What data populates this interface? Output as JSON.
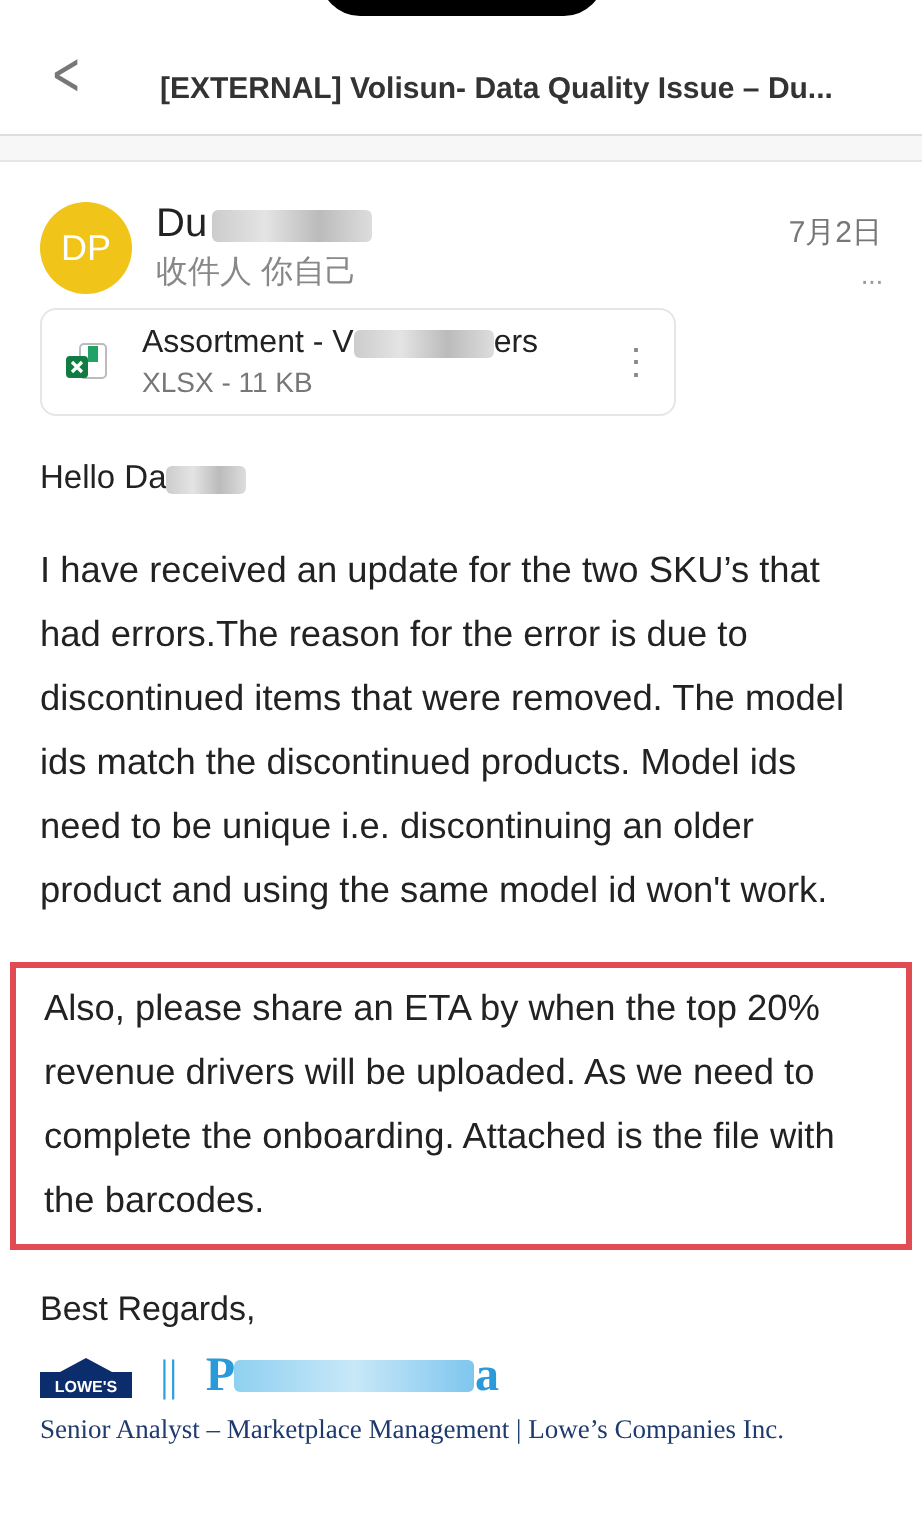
{
  "header": {
    "back": "<",
    "title": "[EXTERNAL] Volisun- Data Quality Issue – Du..."
  },
  "message": {
    "avatar": "DP",
    "sender": "Du",
    "recipient": "收件人 你自己",
    "date": "7月2日",
    "more": "···"
  },
  "attachment": {
    "name_start": "Assortment - V",
    "name_end": "ers",
    "meta": "XLSX - 11 KB",
    "menu": "⋮"
  },
  "body": {
    "greeting": "Hello Da",
    "paragraphs": [
      {
        "text": "I have received an update for the two SKU’s that had errors.The reason for the error is due to discontinued items that were removed.  The model ids match the discontinued products. Model ids need to be unique i.e. discontinuing an older product and using the same model id won't work.",
        "highlighted": false
      },
      {
        "text": "Also, please share an ETA by when the top 20% revenue drivers will be uploaded. As we need to complete the onboarding. Attached is the file with the barcodes.",
        "highlighted": true
      }
    ]
  },
  "signature": {
    "closing": "Best Regards,",
    "logo": "LOWE'S",
    "separator": "||",
    "name_start": "P",
    "name_end": "a",
    "title": "Senior Analyst – Marketplace Management |  Lowe’s Companies Inc."
  }
}
